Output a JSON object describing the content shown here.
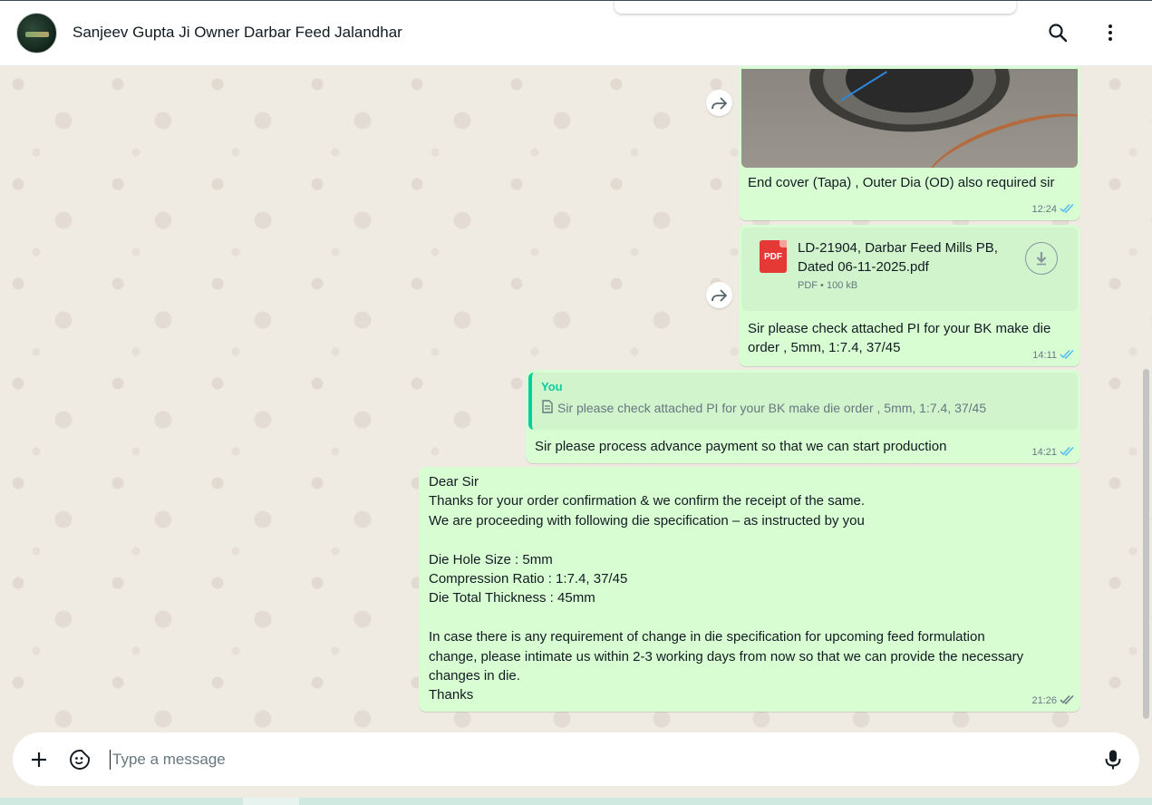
{
  "header": {
    "contact_name": "Sanjeev Gupta Ji Owner Darbar Feed Jalandhar"
  },
  "messages": {
    "image_message": {
      "caption": "End cover (Tapa) , Outer Dia (OD) also required sir",
      "time": "12:24"
    },
    "document_message": {
      "file_name": "LD-21904, Darbar Feed Mills PB, Dated 06-11-2025.pdf",
      "file_type_badge": "PDF",
      "file_meta": "PDF • 100 kB",
      "caption": "Sir please check attached PI for your BK make die order , 5mm, 1:7.4, 37/45",
      "time": "14:11"
    },
    "reply_message": {
      "quoted_author": "You",
      "quoted_text": "Sir please check attached PI for your BK make die order , 5mm, 1:7.4, 37/45",
      "text": "Sir please process advance payment so that we can start production",
      "time": "14:21"
    },
    "long_message": {
      "lines": [
        "Dear Sir",
        "Thanks for your order confirmation & we confirm the receipt of the same.",
        "We are proceeding with following die specification – as instructed by you",
        "",
        "Die Hole Size : 5mm",
        "Compression Ratio : 1:7.4, 37/45",
        "Die Total Thickness : 45mm",
        "",
        "In case there is any requirement of change in die specification for upcoming feed formulation",
        "change, please intimate us within 2-3 working days from now so that we can provide the necessary",
        "changes in die.",
        "Thanks"
      ],
      "time": "21:26"
    }
  },
  "composer": {
    "placeholder": "Type a message"
  },
  "icons": {
    "search": "search-icon",
    "menu": "more-vertical-icon",
    "forward": "forward-icon",
    "attach": "plus-icon",
    "sticker": "sticker-icon",
    "mic": "microphone-icon",
    "read_receipt": "double-check-icon",
    "download": "download-icon",
    "document": "document-icon"
  },
  "colors": {
    "outgoing_bubble": "#d9fdd3",
    "read_tick": "#53bdeb",
    "delivered_tick": "#667781",
    "quote_accent": "#06cf9c",
    "pdf_red": "#e53935"
  }
}
